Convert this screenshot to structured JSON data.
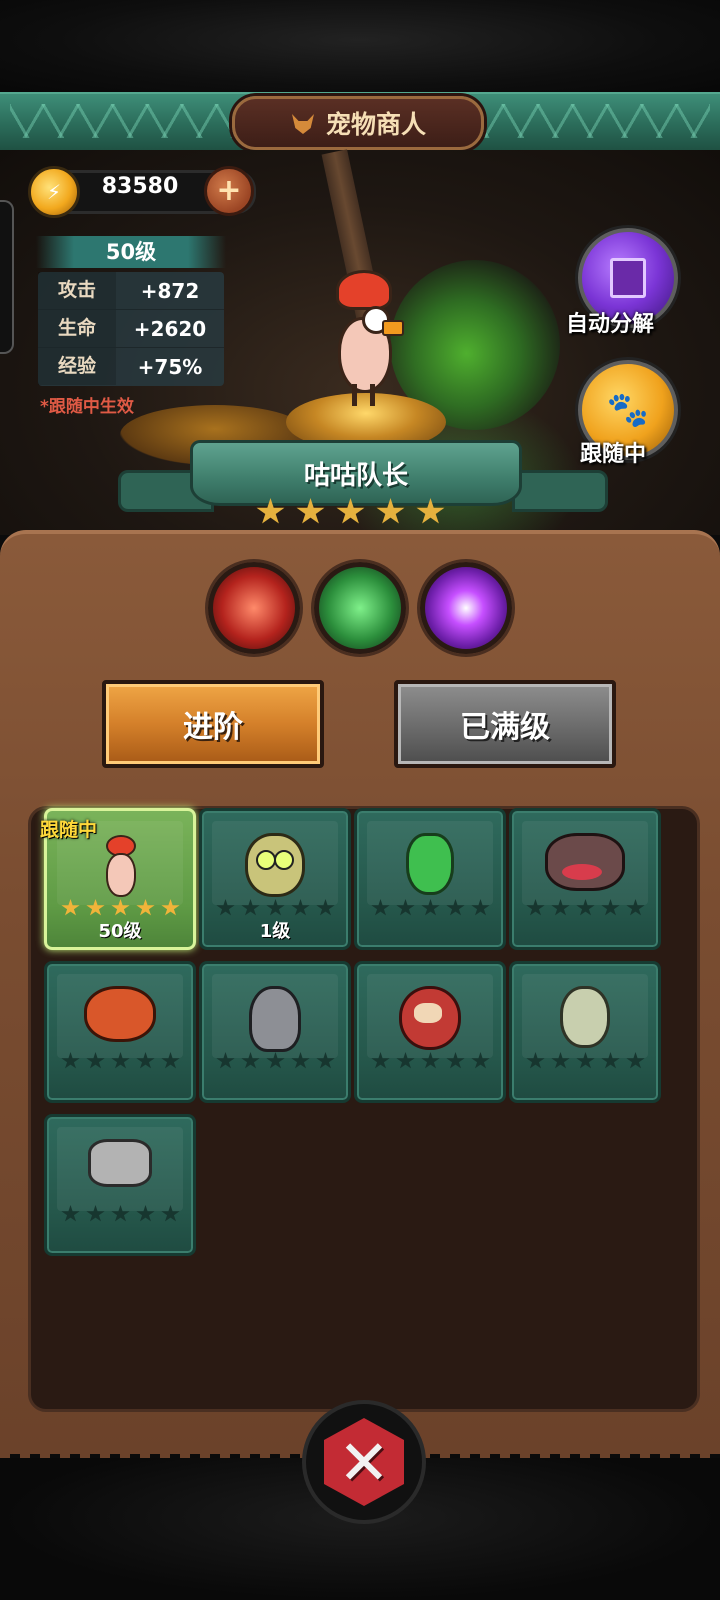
{
  "header": {
    "title": "宠物商人",
    "icon": "fox-head-icon"
  },
  "currency": {
    "gold": "83580",
    "icon": "gold-coin-icon",
    "add_icon": "plus-icon"
  },
  "stats": {
    "level": "50级",
    "rows": [
      {
        "label": "攻击",
        "value": "+872"
      },
      {
        "label": "生命",
        "value": "+2620"
      },
      {
        "label": "经验",
        "value": "+75%"
      }
    ],
    "note": "*跟随中生效"
  },
  "side_buttons": {
    "decompose": {
      "label": "自动分解",
      "icon": "document-icon"
    },
    "follow": {
      "label": "跟随中",
      "icon": "paw-icon"
    }
  },
  "pet": {
    "name": "咕咕队长",
    "stars": 5
  },
  "skills": [
    "red-slash-skill-icon",
    "green-claw-skill-icon",
    "purple-orb-skill-icon"
  ],
  "actions": {
    "advance": "进阶",
    "maxed": "已满级"
  },
  "grid": {
    "follow_tag": "跟随中",
    "pets": [
      {
        "art": "chicken",
        "stars_filled": 5,
        "level": "50级",
        "active": true
      },
      {
        "art": "owl",
        "stars_filled": 0,
        "level": "1级",
        "active": false
      },
      {
        "art": "frog",
        "stars_filled": 0,
        "level": "",
        "active": false
      },
      {
        "art": "tongue-monster",
        "stars_filled": 0,
        "level": "",
        "active": false
      },
      {
        "art": "dragon",
        "stars_filled": 0,
        "level": "",
        "active": false
      },
      {
        "art": "knight",
        "stars_filled": 0,
        "level": "",
        "active": false
      },
      {
        "art": "daruma",
        "stars_filled": 0,
        "level": "",
        "active": false
      },
      {
        "art": "zombie",
        "stars_filled": 0,
        "level": "",
        "active": false
      },
      {
        "art": "armored-hand",
        "stars_filled": 0,
        "level": "",
        "active": false
      }
    ]
  },
  "close": {
    "icon": "close-icon"
  },
  "colors": {
    "accent_teal": "#3e8e78",
    "gold": "#e5b13e",
    "panel_brown": "#7a4d31",
    "note_red": "#e05a45"
  }
}
